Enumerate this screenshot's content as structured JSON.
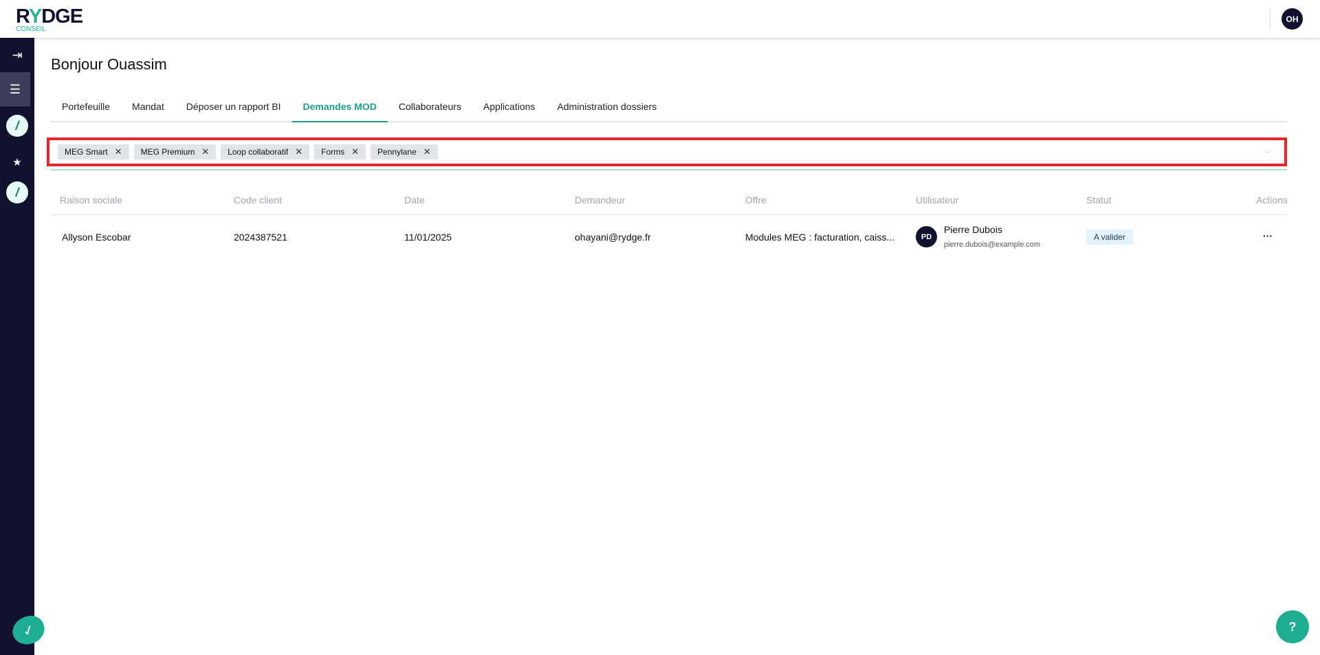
{
  "header": {
    "logo_main": "RYDGE",
    "logo_sub": "CONSEIL",
    "user_initials": "OH"
  },
  "page_title": "Bonjour Ouassim",
  "tabs": [
    "Portefeuille",
    "Mandat",
    "Déposer un rapport BI",
    "Demandes MOD",
    "Collaborateurs",
    "Applications",
    "Administration dossiers"
  ],
  "active_tab": "Demandes MOD",
  "filter": {
    "chips": [
      "MEG Smart",
      "MEG Premium",
      "Loop collaboratif",
      "Forms",
      "Pennylane"
    ]
  },
  "table": {
    "headers": [
      "Raison sociale",
      "Code client",
      "Date",
      "Demandeur",
      "Offre",
      "Utilisateur",
      "Statut",
      "Actions"
    ],
    "rows": [
      {
        "raison_sociale": "Allyson Escobar",
        "code_client": "2024387521",
        "date": "11/01/2025",
        "demandeur": "ohayani@rydge.fr",
        "offre": "Modules MEG : facturation, caiss...",
        "user_initials": "PD",
        "user_name": "Pierre Dubois",
        "user_email": "pierre.dubois@example.com",
        "statut": "A valider",
        "actions": "···"
      }
    ]
  },
  "help": "?",
  "colors": {
    "brand": "#11122e",
    "accent": "#1fae94",
    "highlight": "#e8232b"
  }
}
